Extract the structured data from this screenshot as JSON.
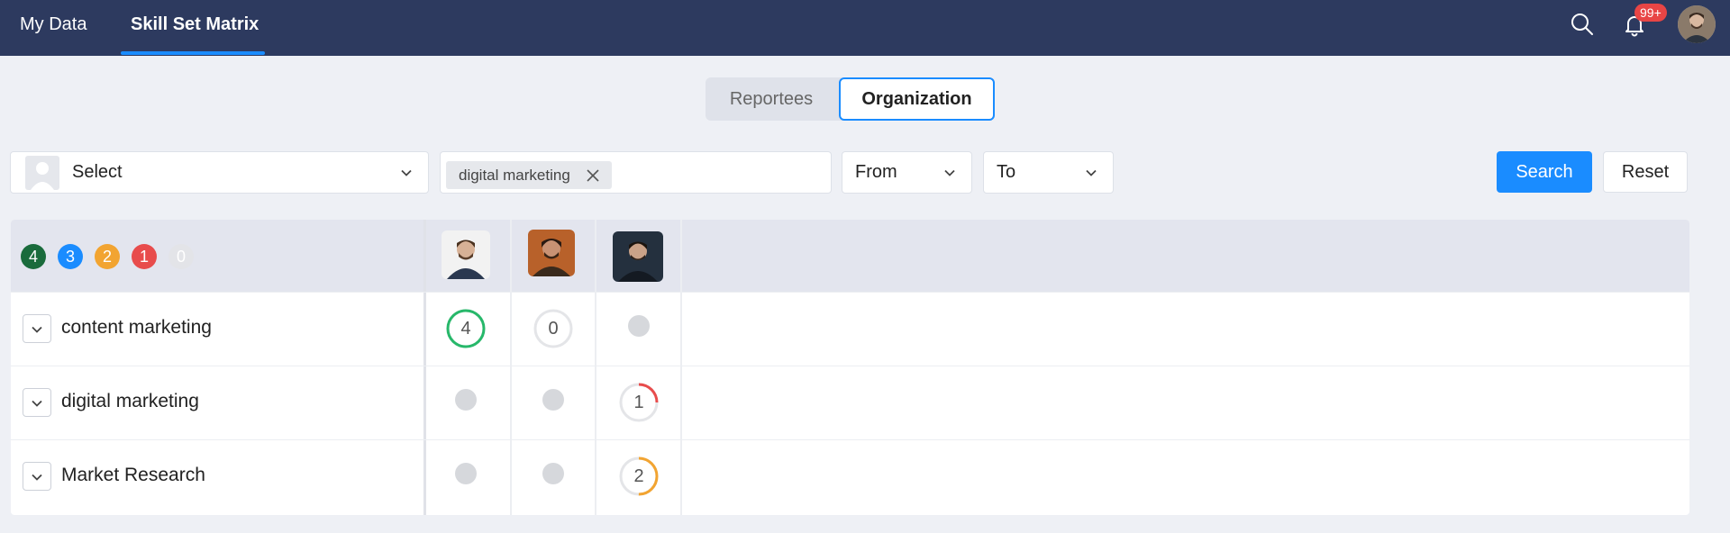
{
  "nav": {
    "tabs": [
      {
        "label": "My Data",
        "active": false
      },
      {
        "label": "Skill Set Matrix",
        "active": true
      }
    ],
    "notification_count": "99+",
    "icons": [
      "search-icon",
      "bell-icon"
    ]
  },
  "toggle": {
    "options": [
      "Reportees",
      "Organization"
    ],
    "selected": "Organization"
  },
  "filters": {
    "employee_select": {
      "value": "Select"
    },
    "skill_tags": [
      "digital marketing"
    ],
    "from": {
      "value": "From"
    },
    "to": {
      "value": "To"
    },
    "search_label": "Search",
    "reset_label": "Reset"
  },
  "legend": [
    {
      "level": "4",
      "color": "#1a6b3c"
    },
    {
      "level": "3",
      "color": "#1a8cff"
    },
    {
      "level": "2",
      "color": "#f2a431"
    },
    {
      "level": "1",
      "color": "#e84c4c"
    },
    {
      "level": "0",
      "color": "#e3e4e8"
    }
  ],
  "matrix": {
    "skills": [
      {
        "name": "content marketing",
        "ratings": [
          4,
          0,
          null
        ]
      },
      {
        "name": "digital marketing",
        "ratings": [
          null,
          null,
          1
        ]
      },
      {
        "name": "Market Research",
        "ratings": [
          null,
          null,
          2
        ]
      }
    ],
    "level_colors": {
      "4": "#27b86a",
      "3": "#1a8cff",
      "2": "#f2a431",
      "1": "#e84c4c",
      "0": "#d0d2d6"
    },
    "max_level": 4
  }
}
